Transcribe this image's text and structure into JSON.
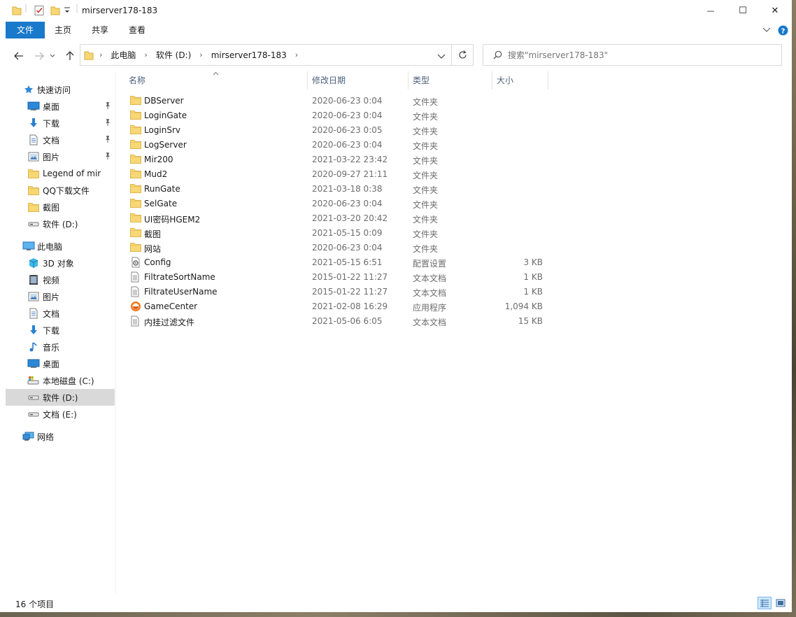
{
  "window": {
    "title": "mirserver178-183",
    "minimize_glyph": "—",
    "maximize_glyph": "☐",
    "close_glyph": "✕"
  },
  "ribbon": {
    "tabs": [
      {
        "id": "file",
        "label": "文件"
      },
      {
        "id": "home",
        "label": "主页"
      },
      {
        "id": "share",
        "label": "共享"
      },
      {
        "id": "view",
        "label": "查看"
      }
    ]
  },
  "address": {
    "crumbs": [
      "此电脑",
      "软件 (D:)",
      "mirserver178-183"
    ]
  },
  "search": {
    "placeholder": "搜索\"mirserver178-183\""
  },
  "sidebar": {
    "quick_access": {
      "label": "快速访问",
      "icon": "star-icon"
    },
    "quick_items": [
      {
        "label": "桌面",
        "icon": "desktop-icon",
        "pinned": true
      },
      {
        "label": "下载",
        "icon": "download-icon",
        "pinned": true
      },
      {
        "label": "文档",
        "icon": "document-icon",
        "pinned": true
      },
      {
        "label": "图片",
        "icon": "picture-icon",
        "pinned": true
      },
      {
        "label": "Legend of mir",
        "icon": "folder-icon",
        "pinned": false
      },
      {
        "label": "QQ下载文件",
        "icon": "folder-icon",
        "pinned": false
      },
      {
        "label": "截图",
        "icon": "folder-icon",
        "pinned": false
      },
      {
        "label": "软件 (D:)",
        "icon": "drive-icon",
        "pinned": false
      }
    ],
    "this_pc": {
      "label": "此电脑",
      "icon": "computer-icon"
    },
    "pc_items": [
      {
        "label": "3D 对象",
        "icon": "cube-icon"
      },
      {
        "label": "视频",
        "icon": "video-icon"
      },
      {
        "label": "图片",
        "icon": "picture-icon"
      },
      {
        "label": "文档",
        "icon": "document-icon"
      },
      {
        "label": "下载",
        "icon": "download-icon"
      },
      {
        "label": "音乐",
        "icon": "music-icon"
      },
      {
        "label": "桌面",
        "icon": "desktop-icon"
      },
      {
        "label": "本地磁盘 (C:)",
        "icon": "system-drive-icon"
      },
      {
        "label": "软件 (D:)",
        "icon": "drive-icon",
        "selected": true
      },
      {
        "label": "文档 (E:)",
        "icon": "drive-icon"
      }
    ],
    "network": {
      "label": "网络",
      "icon": "network-icon"
    }
  },
  "columns": {
    "name": "名称",
    "date": "修改日期",
    "type": "类型",
    "size": "大小"
  },
  "files": [
    {
      "name": "DBServer",
      "date": "2020-06-23 0:04",
      "type": "文件夹",
      "size": "",
      "icon": "folder-icon"
    },
    {
      "name": "LoginGate",
      "date": "2020-06-23 0:04",
      "type": "文件夹",
      "size": "",
      "icon": "folder-icon"
    },
    {
      "name": "LoginSrv",
      "date": "2020-06-23 0:05",
      "type": "文件夹",
      "size": "",
      "icon": "folder-icon"
    },
    {
      "name": "LogServer",
      "date": "2020-06-23 0:04",
      "type": "文件夹",
      "size": "",
      "icon": "folder-icon"
    },
    {
      "name": "Mir200",
      "date": "2021-03-22 23:42",
      "type": "文件夹",
      "size": "",
      "icon": "folder-icon"
    },
    {
      "name": "Mud2",
      "date": "2020-09-27 21:11",
      "type": "文件夹",
      "size": "",
      "icon": "folder-icon"
    },
    {
      "name": "RunGate",
      "date": "2021-03-18 0:38",
      "type": "文件夹",
      "size": "",
      "icon": "folder-icon"
    },
    {
      "name": "SelGate",
      "date": "2020-06-23 0:04",
      "type": "文件夹",
      "size": "",
      "icon": "folder-icon"
    },
    {
      "name": "UI密码HGEM2",
      "date": "2021-03-20 20:42",
      "type": "文件夹",
      "size": "",
      "icon": "folder-icon"
    },
    {
      "name": "截图",
      "date": "2021-05-15 0:09",
      "type": "文件夹",
      "size": "",
      "icon": "folder-icon"
    },
    {
      "name": "网站",
      "date": "2020-06-23 0:04",
      "type": "文件夹",
      "size": "",
      "icon": "folder-icon"
    },
    {
      "name": "Config",
      "date": "2021-05-15 6:51",
      "type": "配置设置",
      "size": "3 KB",
      "icon": "config-file-icon"
    },
    {
      "name": "FiltrateSortName",
      "date": "2015-01-22 11:27",
      "type": "文本文档",
      "size": "1 KB",
      "icon": "text-file-icon"
    },
    {
      "name": "FiltrateUserName",
      "date": "2015-01-22 11:27",
      "type": "文本文档",
      "size": "1 KB",
      "icon": "text-file-icon"
    },
    {
      "name": "GameCenter",
      "date": "2021-02-08 16:29",
      "type": "应用程序",
      "size": "1,094 KB",
      "icon": "app-icon"
    },
    {
      "name": "内挂过滤文件",
      "date": "2021-05-06 6:05",
      "type": "文本文档",
      "size": "15 KB",
      "icon": "text-file-icon"
    }
  ],
  "status": {
    "item_count": "16 个项目"
  },
  "colors": {
    "accent": "#1979ca",
    "folder": "#f8d775",
    "selection": "#d9d9d9"
  }
}
